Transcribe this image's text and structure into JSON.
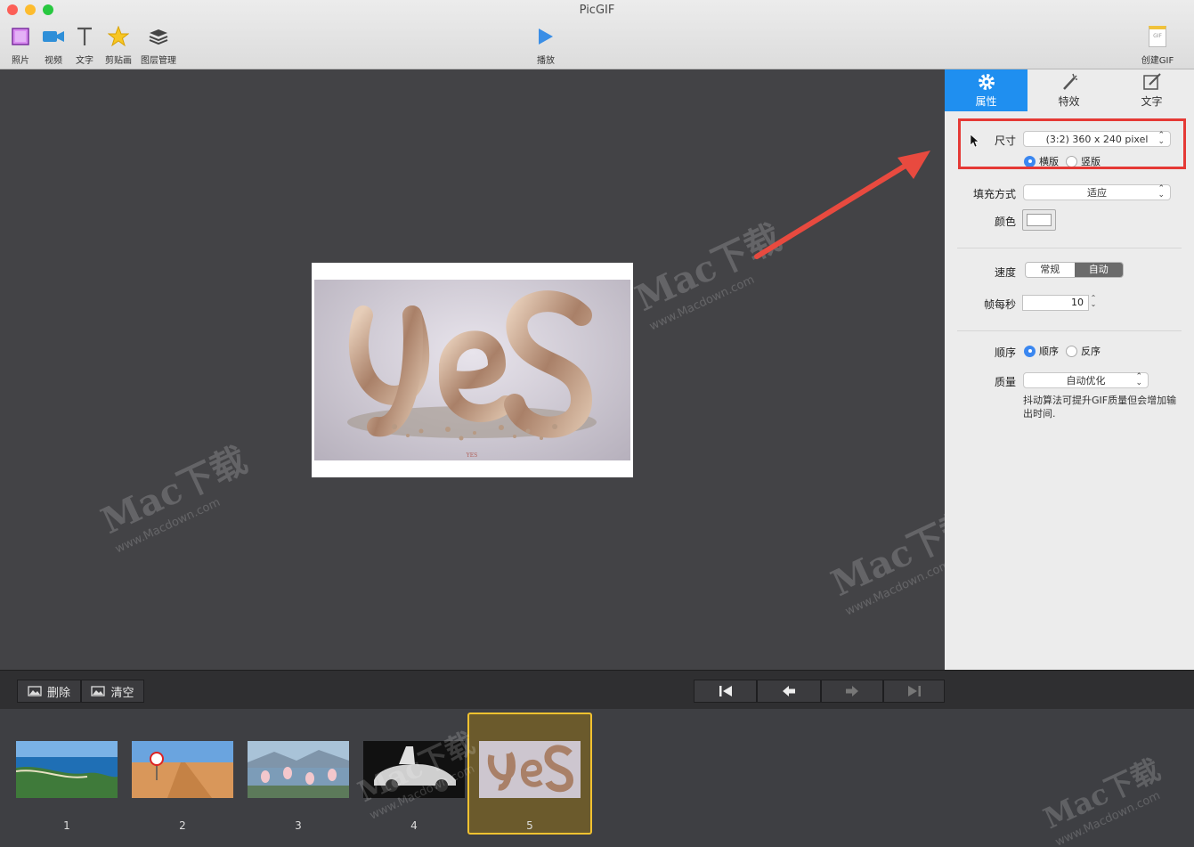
{
  "window": {
    "title": "PicGIF"
  },
  "toolbar": {
    "photo": "照片",
    "video": "视频",
    "text": "文字",
    "sticker": "剪贴画",
    "layers": "图层管理",
    "play": "播放",
    "create": "创建GIF",
    "gif_badge": "GIF"
  },
  "panel": {
    "tabs": [
      {
        "label": "属性",
        "icon": "gear-icon",
        "active": true
      },
      {
        "label": "特效",
        "icon": "magic-wand-icon",
        "active": false
      },
      {
        "label": "文字",
        "icon": "edit-icon",
        "active": false
      }
    ],
    "size_label": "尺寸",
    "size_value": "(3:2) 360 x 240 pixel",
    "orientation_landscape": "横版",
    "orientation_portrait": "竖版",
    "fill_label": "填充方式",
    "fill_value": "适应",
    "color_label": "颜色",
    "color_value": "#ffffff",
    "speed_label": "速度",
    "speed_normal": "常规",
    "speed_auto": "自动",
    "fps_label": "帧每秒",
    "fps_value": "10",
    "order_label": "顺序",
    "order_forward": "顺序",
    "order_reverse": "反序",
    "quality_label": "质量",
    "quality_value": "自动优化",
    "quality_note": "抖动算法可提升GIF质量但会增加输出时间."
  },
  "bottom": {
    "delete": "删除",
    "clear": "清空"
  },
  "frames": [
    {
      "num": "1",
      "selected": false
    },
    {
      "num": "2",
      "selected": false
    },
    {
      "num": "3",
      "selected": false
    },
    {
      "num": "4",
      "selected": false
    },
    {
      "num": "5",
      "selected": true
    }
  ],
  "preview": {
    "caption": "YES"
  },
  "watermark": {
    "brand": "Mac下载",
    "url": "www.Macdown.com"
  },
  "colors": {
    "accent": "#1f8ff0",
    "highlight": "#e53935",
    "selected_frame": "#f2c230"
  }
}
